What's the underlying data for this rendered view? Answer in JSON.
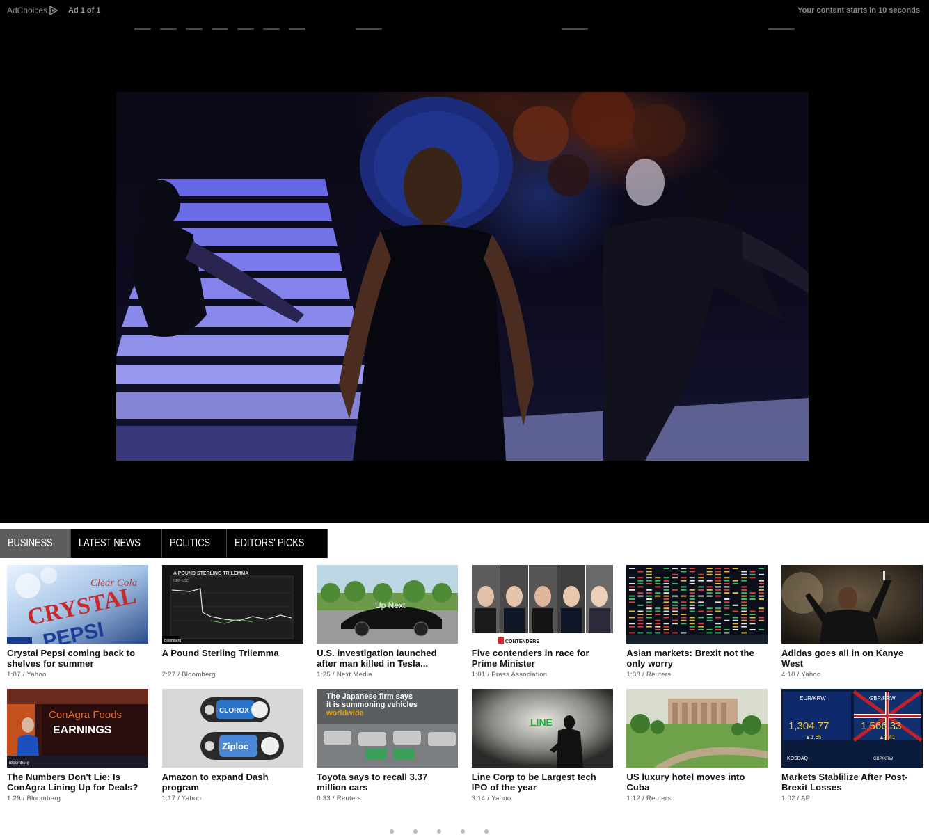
{
  "ad": {
    "adchoices_label": "AdChoices",
    "adchoices_icon": "adchoices-triangle-icon",
    "ad_count": "Ad 1 of 1",
    "countdown": "Your content starts in 10 seconds"
  },
  "tabs": [
    {
      "label": "BUSINESS",
      "active": true
    },
    {
      "label": "LATEST NEWS",
      "active": false
    },
    {
      "label": "POLITICS",
      "active": false
    },
    {
      "label": "EDITORS' PICKS",
      "active": false
    }
  ],
  "cards": [
    {
      "title": "Crystal Pepsi coming back to shelves for summer",
      "duration": "1:07",
      "source": "Yahoo",
      "thumb_text": "Clear Cola CRYSTAL PEPSI"
    },
    {
      "title": "A Pound Sterling Trilemma",
      "duration": "2:27",
      "source": "Bloomberg",
      "thumb_text": "A POUND STERLING TRILEMMA"
    },
    {
      "title": "U.S. investigation launched after man killed in Tesla...",
      "duration": "1:25",
      "source": "Next Media",
      "thumb_text": "Up Next"
    },
    {
      "title": "Five contenders in race for Prime Minister",
      "duration": "1:01",
      "source": "Press Association",
      "thumb_text": "5 CONTENDERS"
    },
    {
      "title": "Asian markets: Brexit not the only worry",
      "duration": "1:38",
      "source": "Reuters",
      "thumb_text": ""
    },
    {
      "title": "Adidas goes all in on Kanye West",
      "duration": "4:10",
      "source": "Yahoo",
      "thumb_text": ""
    },
    {
      "title": "The Numbers Don't Lie: Is ConAgra Lining Up for Deals?",
      "duration": "1:29",
      "source": "Bloomberg",
      "thumb_text": "ConAgra Foods EARNINGS"
    },
    {
      "title": "Amazon to expand Dash program",
      "duration": "1:17",
      "source": "Yahoo",
      "thumb_text": "Ziploc"
    },
    {
      "title": "Toyota says to recall 3.37 million cars",
      "duration": "0:33",
      "source": "Reuters",
      "thumb_text": "The Japanese firm says it is summoning vehicles worldwide"
    },
    {
      "title": "Line Corp to be Largest tech IPO of the year",
      "duration": "3:14",
      "source": "Yahoo",
      "thumb_text": "LINE"
    },
    {
      "title": "US luxury hotel moves into Cuba",
      "duration": "1:12",
      "source": "Reuters",
      "thumb_text": ""
    },
    {
      "title": "Markets Stablilize After Post-Brexit Losses",
      "duration": "1:02",
      "source": "AP",
      "thumb_text": "EUR/KRW 1,304.77 GBP/KRW 1,566.33"
    }
  ],
  "meta_separator": " / "
}
